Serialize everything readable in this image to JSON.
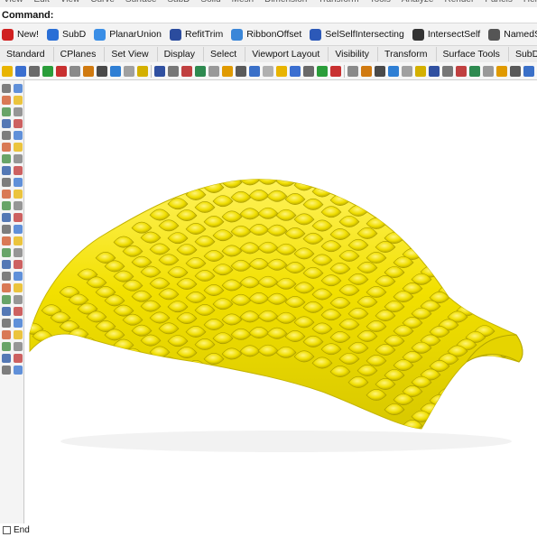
{
  "menu": {
    "items": [
      "View",
      "Edit",
      "View",
      "Curve",
      "Surface",
      "SubD",
      "Solid",
      "Mesh",
      "Dimension",
      "Transform",
      "Tools",
      "Analyze",
      "Render",
      "Panels",
      "Help"
    ]
  },
  "command": {
    "label": "Command:"
  },
  "macros": [
    {
      "label": "New!",
      "icon": "new-icon",
      "color": "#d02020"
    },
    {
      "label": "SubD",
      "icon": "subd-icon",
      "color": "#2a6fd6"
    },
    {
      "label": "PlanarUnion",
      "icon": "planar-union-icon",
      "color": "#3a8ee6"
    },
    {
      "label": "RefitTrim",
      "icon": "refit-trim-icon",
      "color": "#2b4c9e"
    },
    {
      "label": "RibbonOffset",
      "icon": "ribbon-offset-icon",
      "color": "#3a86d8"
    },
    {
      "label": "SelSelfIntersecting",
      "icon": "sel-self-intersecting-icon",
      "color": "#2c59b8"
    },
    {
      "label": "IntersectSelf",
      "icon": "intersect-self-icon",
      "color": "#333333"
    },
    {
      "label": "NamedSelections",
      "icon": "named-selections-icon",
      "color": "#555555"
    }
  ],
  "tabs": [
    "Standard",
    "CPlanes",
    "Set View",
    "Display",
    "Select",
    "Viewport Layout",
    "Visibility",
    "Transform",
    "Surface Tools",
    "SubD Tools"
  ],
  "status": {
    "end_label": "End"
  },
  "colors": {
    "surface_yellow": "#f5e400",
    "surface_shadow": "#c9ba00",
    "viewport_bg": "#ffffff"
  }
}
